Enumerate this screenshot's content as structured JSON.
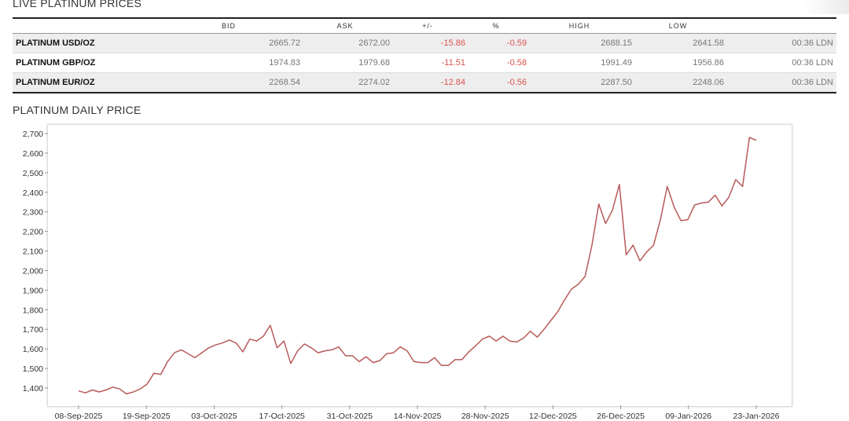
{
  "live": {
    "title": "LIVE PLATINUM PRICES",
    "columns": [
      "",
      "BID",
      "ASK",
      "+/-",
      "%",
      "HIGH",
      "LOW",
      ""
    ],
    "rows": [
      {
        "name": "PLATINUM USD/OZ",
        "bid": "2665.72",
        "ask": "2672.00",
        "change": "-15.86",
        "pct": "-0.59",
        "high": "2688.15",
        "low": "2641.58",
        "time": "00:36 LDN"
      },
      {
        "name": "PLATINUM GBP/OZ",
        "bid": "1974.83",
        "ask": "1979.68",
        "change": "-11.51",
        "pct": "-0.58",
        "high": "1991.49",
        "low": "1956.86",
        "time": "00:36 LDN"
      },
      {
        "name": "PLATINUM EUR/OZ",
        "bid": "2268.54",
        "ask": "2274.02",
        "change": "-12.84",
        "pct": "-0.56",
        "high": "2287.50",
        "low": "2248.06",
        "time": "00:36 LDN"
      }
    ]
  },
  "colors": {
    "line": "#b85a5a",
    "negative": "#d9534f"
  },
  "chart_data": {
    "type": "line",
    "title": "PLATINUM DAILY PRICE",
    "xlabel": "",
    "ylabel": "",
    "ylim": [
      1330,
      2730
    ],
    "yticks": [
      "2,700",
      "2,600",
      "2,500",
      "2,400",
      "2,300",
      "2,200",
      "2,100",
      "2,000",
      "1,900",
      "1,800",
      "1,700",
      "1,600",
      "1,500",
      "1,400"
    ],
    "ytick_values": [
      2700,
      2600,
      2500,
      2400,
      2300,
      2200,
      2100,
      2000,
      1900,
      1800,
      1700,
      1600,
      1500,
      1400
    ],
    "xticks": [
      "08-Sep-2025",
      "19-Sep-2025",
      "03-Oct-2025",
      "17-Oct-2025",
      "31-Oct-2025",
      "14-Nov-2025",
      "28-Nov-2025",
      "12-Dec-2025",
      "26-Dec-2025",
      "09-Jan-2026",
      "23-Jan-2026"
    ],
    "grid": false,
    "series": [
      {
        "values": [
          1385,
          1375,
          1390,
          1380,
          1390,
          1405,
          1395,
          1370,
          1380,
          1395,
          1420,
          1475,
          1470,
          1535,
          1580,
          1595,
          1575,
          1555,
          1580,
          1605,
          1620,
          1630,
          1645,
          1630,
          1585,
          1650,
          1640,
          1665,
          1720,
          1605,
          1640,
          1525,
          1590,
          1625,
          1605,
          1580,
          1590,
          1595,
          1610,
          1565,
          1565,
          1535,
          1560,
          1530,
          1540,
          1575,
          1580,
          1610,
          1590,
          1535,
          1530,
          1530,
          1555,
          1515,
          1515,
          1545,
          1545,
          1585,
          1615,
          1650,
          1665,
          1640,
          1665,
          1640,
          1635,
          1655,
          1690,
          1660,
          1700,
          1745,
          1790,
          1850,
          1905,
          1930,
          1970,
          2130,
          2340,
          2240,
          2310,
          2440,
          2080,
          2130,
          2050,
          2095,
          2130,
          2260,
          2430,
          2325,
          2255,
          2260,
          2335,
          2345,
          2350,
          2385,
          2330,
          2375,
          2465,
          2430,
          2680,
          2665
        ]
      }
    ]
  }
}
